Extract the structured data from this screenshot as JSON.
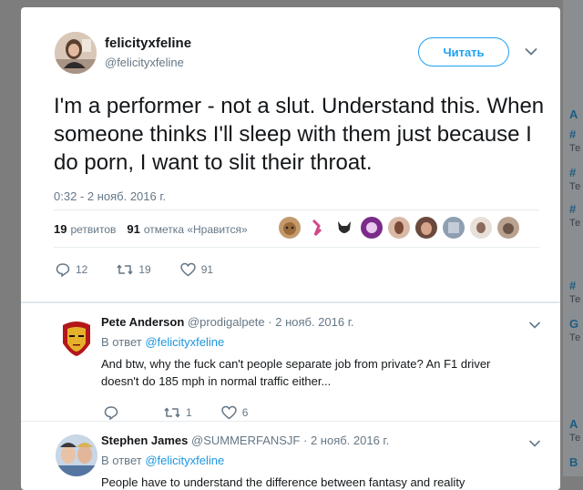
{
  "backdrop": {
    "peeks": [
      "A",
      "#",
      "Те",
      "#",
      "Те",
      "#",
      "Те",
      "#",
      "Те",
      "G",
      "Те",
      "A",
      "Те",
      "B"
    ]
  },
  "tweet": {
    "author_name": "felicityxfeline",
    "author_handle": "@felicityxfeline",
    "follow_label": "Читать",
    "text": "I'm a performer - not a slut. Understand this. When someone thinks I'll sleep with them just because I do porn, I want to slit their throat.",
    "timestamp": "0:32 - 2 нояб. 2016 г.",
    "retweets_count": "19",
    "retweets_label": "ретвитов",
    "likes_count": "91",
    "likes_label": "отметка «Нравится»",
    "actions": {
      "reply_count": "12",
      "retweet_count": "19",
      "like_count": "91"
    }
  },
  "replies": [
    {
      "name": "Pete Anderson",
      "handle": "@prodigalpete",
      "date": "· 2 нояб. 2016 г.",
      "reply_to_label": "В ответ",
      "reply_to_handle": "@felicityxfeline",
      "text": "And btw, why the fuck can't people separate job from private? An F1 driver doesn't do 185 mph in normal traffic either...",
      "reply_count": "",
      "retweet_count": "1",
      "like_count": "6"
    },
    {
      "name": "Stephen James",
      "handle": "@SUMMERFANSJF",
      "date": "· 2 нояб. 2016 г.",
      "reply_to_label": "В ответ",
      "reply_to_handle": "@felicityxfeline",
      "text": "People have to understand the difference between fantasy and reality"
    }
  ],
  "colors": {
    "accent": "#1da1f2",
    "link": "#1b95e0",
    "muted": "#657786",
    "text": "#14171a"
  },
  "icons": [
    "reply-icon",
    "retweet-icon",
    "heart-icon",
    "chevron-down-icon"
  ]
}
